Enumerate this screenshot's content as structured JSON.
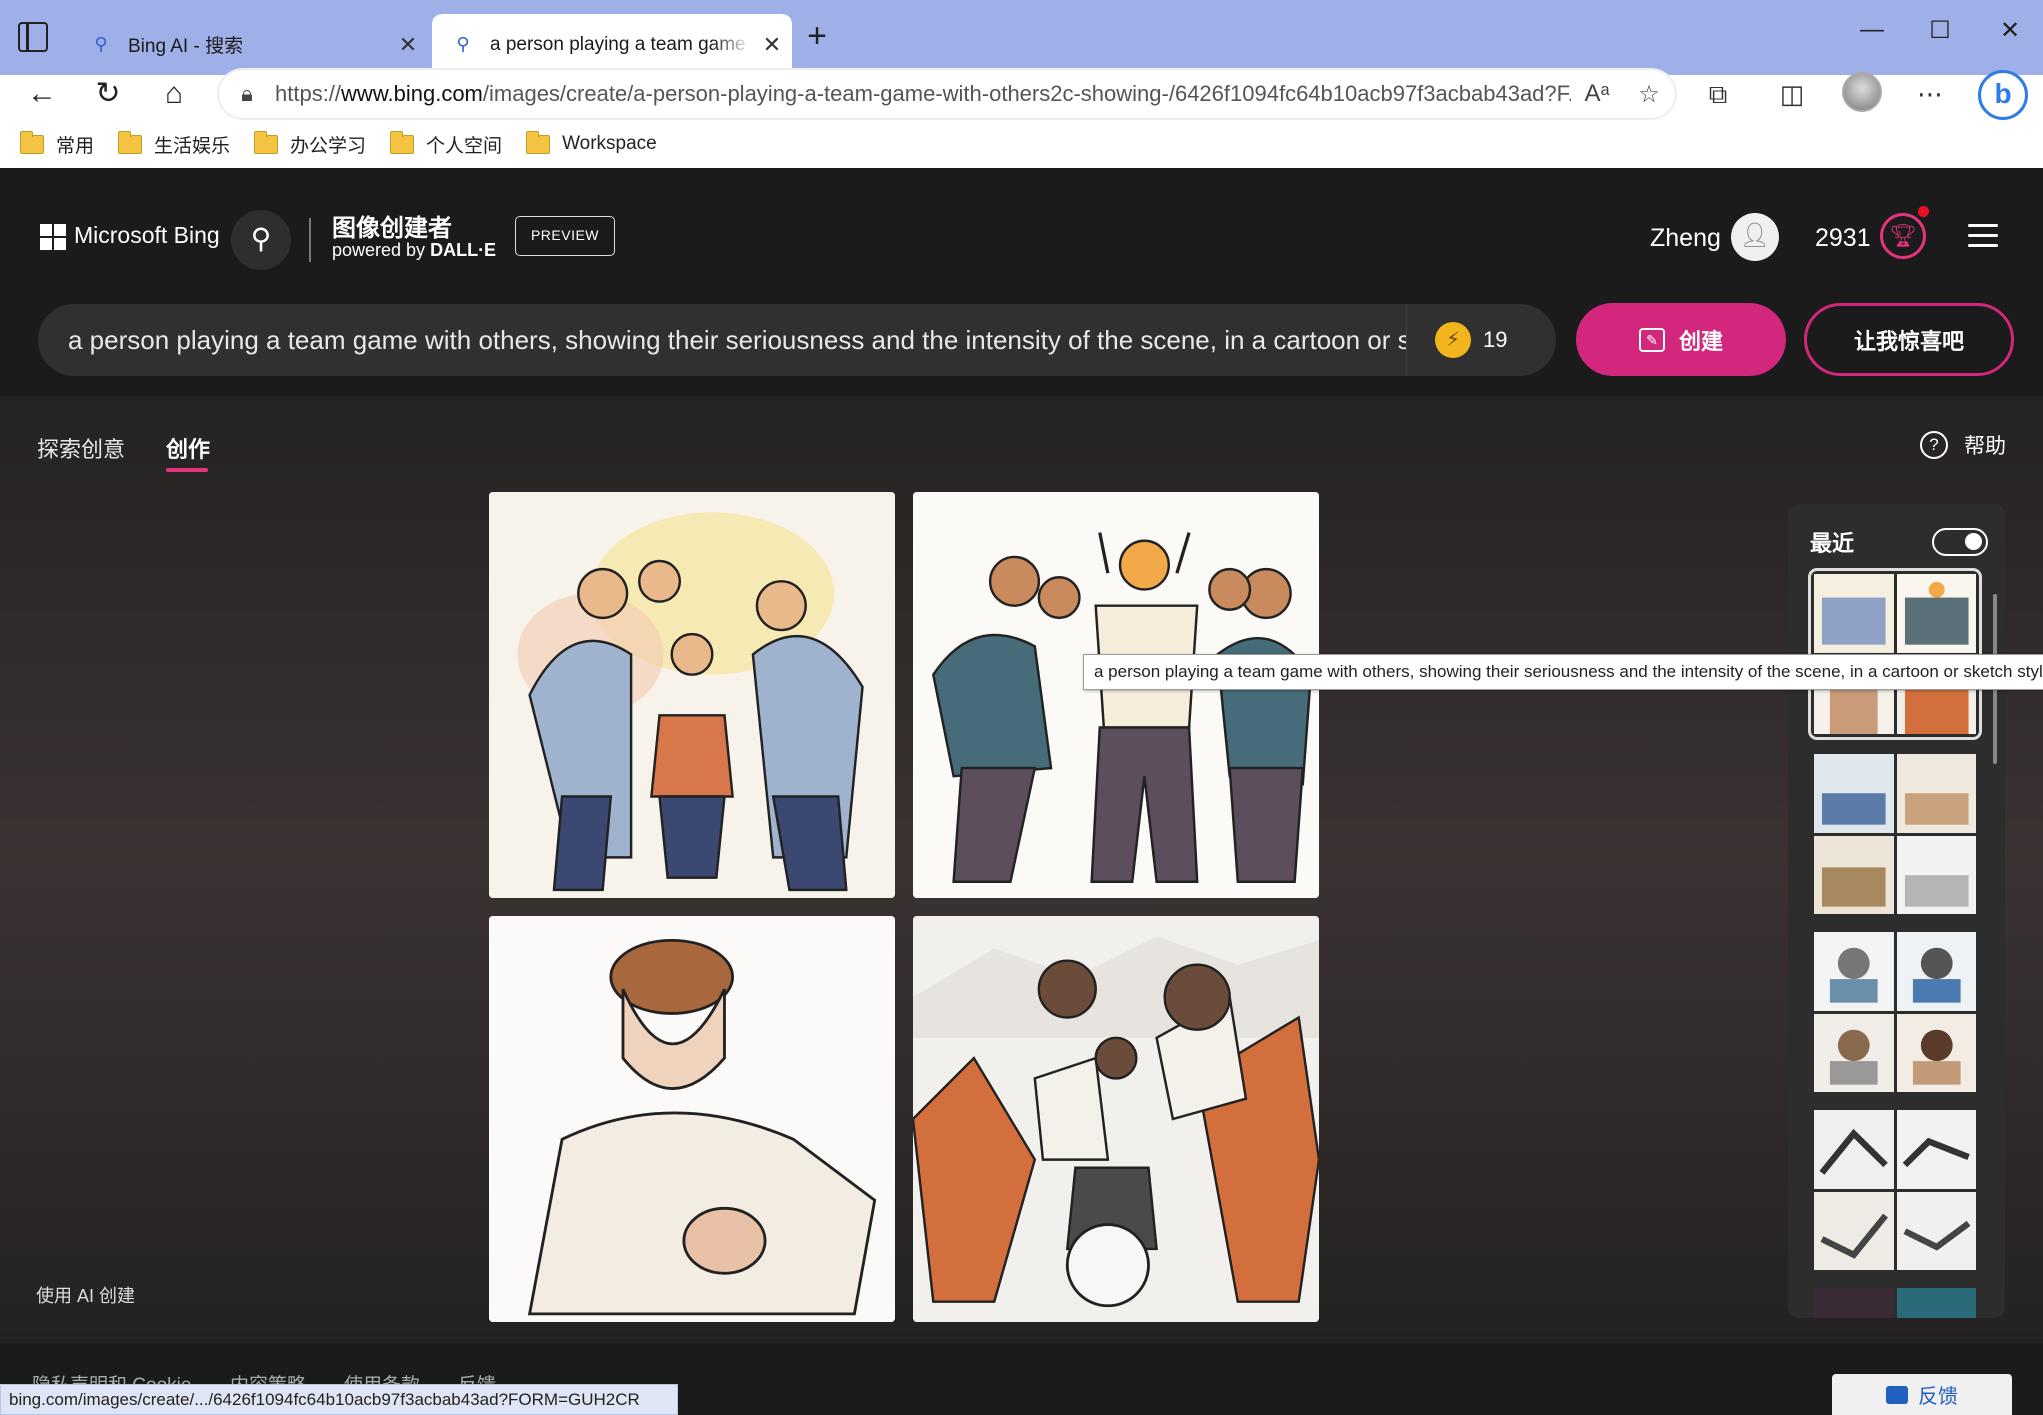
{
  "browser": {
    "tabs": [
      {
        "title": "Bing AI - 搜索",
        "icon": "search-icon"
      },
      {
        "title": "a person playing a team game with others",
        "icon": "search-icon"
      }
    ],
    "url_prefix": "https://",
    "url_domain": "www.bing.com",
    "url_rest": "/images/create/a-person-playing-a-team-game-with-others2c-showing-/6426f1094fc64b10acb97f3acbab43ad?F...",
    "favorites": [
      "常用",
      "生活娱乐",
      "办公学习",
      "个人空间",
      "Workspace"
    ],
    "status_url": "bing.com/images/create/.../6426f1094fc64b10acb97f3acbab43ad?FORM=GUH2CR"
  },
  "bing": {
    "brand": "Microsoft Bing",
    "creator_title": "图像创建者",
    "powered_by": "powered by",
    "dalle": "DALL·E",
    "preview": "PREVIEW",
    "user_name": "Zheng",
    "points": "2931",
    "prompt": "a person playing a team game with others, showing their seriousness and the intensity of the scene, in a cartoon or sketch style",
    "boost_count": "19",
    "create_label": "创建",
    "surprise_label": "让我惊喜吧",
    "nav_explore": "探索创意",
    "nav_create": "创作",
    "help_label": "帮助",
    "recent_title": "最近",
    "tooltip": "a person playing a team game with others, showing their seriousness and the intensity of the scene, in a cartoon or sketch style",
    "made_with_ai": "使用 AI 创建",
    "footer_links": [
      "隐私声明和 Cookie",
      "内容策略",
      "使用条款",
      "反馈"
    ],
    "feedback_label": "反馈"
  },
  "colors": {
    "accent": "#d3267d",
    "tabbar": "#9fb0e8",
    "header": "#1b1b1b"
  }
}
